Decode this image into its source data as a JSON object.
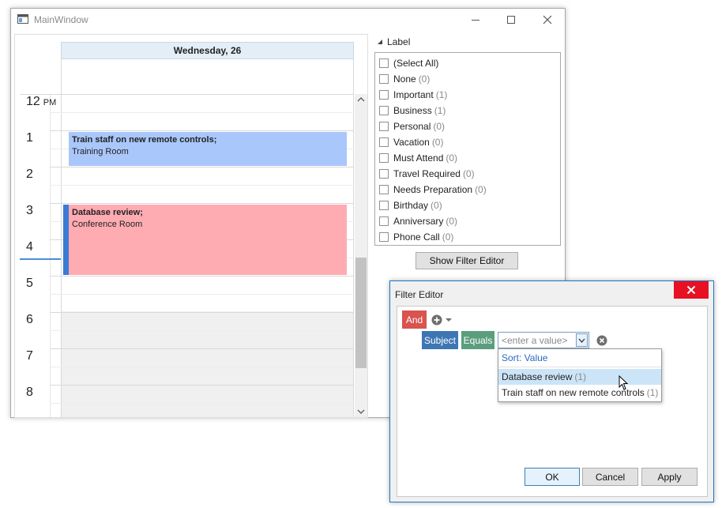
{
  "main_window": {
    "title": "MainWindow",
    "controls": {
      "minimize": "—",
      "maximize": "☐",
      "close": "✕"
    }
  },
  "scheduler": {
    "day_header": "Wednesday, 26",
    "ampm": "PM",
    "hours": [
      "12",
      "1",
      "2",
      "3",
      "4",
      "5",
      "6",
      "7",
      "8"
    ],
    "appointments": [
      {
        "subject": "Train staff on new remote controls;",
        "location": "Training Room",
        "color": "#a9c7fb"
      },
      {
        "subject": "Database review;",
        "location": "Conference Room",
        "color": "#ffabb2",
        "status_color": "#3a7bd5"
      }
    ]
  },
  "filter_panel": {
    "group_title": "Label",
    "items": [
      {
        "label": "(Select All)",
        "count": ""
      },
      {
        "label": "None",
        "count": "(0)"
      },
      {
        "label": "Important",
        "count": "(1)"
      },
      {
        "label": "Business",
        "count": "(1)"
      },
      {
        "label": "Personal",
        "count": "(0)"
      },
      {
        "label": "Vacation",
        "count": "(0)"
      },
      {
        "label": "Must Attend",
        "count": "(0)"
      },
      {
        "label": "Travel Required",
        "count": "(0)"
      },
      {
        "label": "Needs Preparation",
        "count": "(0)"
      },
      {
        "label": "Birthday",
        "count": "(0)"
      },
      {
        "label": "Anniversary",
        "count": "(0)"
      },
      {
        "label": "Phone Call",
        "count": "(0)"
      }
    ],
    "show_filter_editor_label": "Show Filter Editor"
  },
  "filter_editor": {
    "title": "Filter Editor",
    "group_operator": "And",
    "field": "Subject",
    "operator": "Equals",
    "value_placeholder": "<enter a value>",
    "dropdown": {
      "sort_label": "Sort: Value",
      "items": [
        {
          "text": "Database review",
          "count": "(1)",
          "highlighted": true
        },
        {
          "text": "Train staff on new remote controls",
          "count": "(1)",
          "highlighted": false
        }
      ]
    },
    "buttons": {
      "ok": "OK",
      "cancel": "Cancel",
      "apply": "Apply"
    },
    "colors": {
      "and": "#d9534f",
      "field": "#3e76b4",
      "operator": "#5a9e7e",
      "close": "#e81123"
    }
  }
}
